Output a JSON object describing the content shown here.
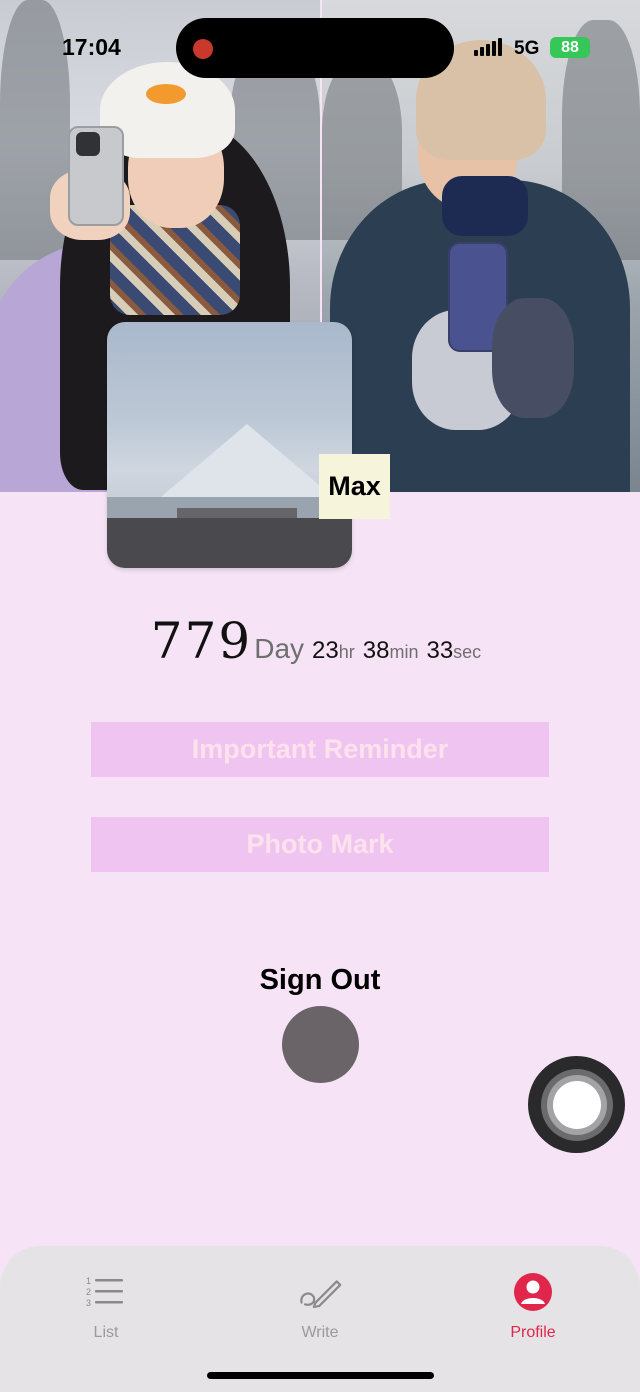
{
  "status_bar": {
    "time": "17:04",
    "network": "5G",
    "battery": "88"
  },
  "header": {
    "partner_name": "Max",
    "thumbnail_subject": "mountain-photo"
  },
  "counter": {
    "days": "779",
    "day_label": "Day",
    "hours": "23",
    "hours_unit": "hr",
    "minutes": "38",
    "minutes_unit": "min",
    "seconds": "33",
    "seconds_unit": "sec"
  },
  "actions": {
    "important_reminder": "Important Reminder",
    "photo_mark": "Photo Mark",
    "sign_out": "Sign Out"
  },
  "tabs": [
    {
      "label": "List",
      "icon": "numbered-list-icon",
      "active": false
    },
    {
      "label": "Write",
      "icon": "pen-icon",
      "active": false
    },
    {
      "label": "Profile",
      "icon": "profile-icon",
      "active": true
    }
  ],
  "colors": {
    "background": "#f6e4f6",
    "pill_background": "#f0c4f0",
    "pill_text": "#fce2ec",
    "active_tab": "#e0264a",
    "inactive_tab": "#9a9a9a"
  }
}
